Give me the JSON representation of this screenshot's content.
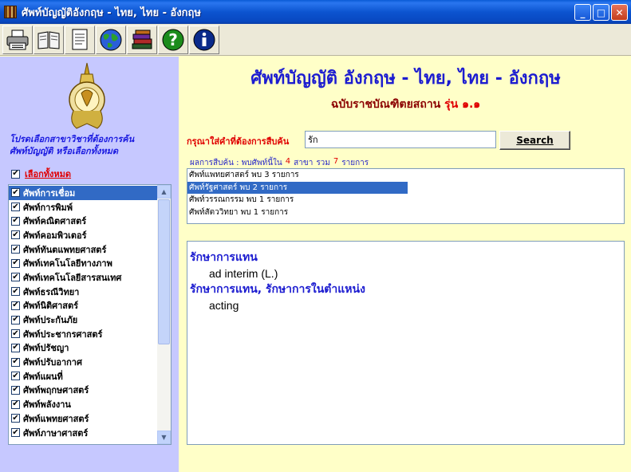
{
  "window": {
    "title": "ศัพท์บัญญัติอังกฤษ - ไทย, ไทย - อังกฤษ",
    "minimize_label": "_",
    "maximize_label": "□",
    "close_label": "✕"
  },
  "toolbar": {
    "buttons": [
      {
        "name": "print",
        "icon": "printer-icon"
      },
      {
        "name": "book",
        "icon": "open-book-icon"
      },
      {
        "name": "document",
        "icon": "document-icon"
      },
      {
        "name": "internet",
        "icon": "globe-icon"
      },
      {
        "name": "library",
        "icon": "stacked-books-icon"
      },
      {
        "name": "help",
        "icon": "question-icon"
      },
      {
        "name": "about",
        "icon": "info-icon"
      }
    ]
  },
  "sidebar": {
    "prompt_line1": "โปรดเลือกสาขาวิชาที่ต้องการค้น",
    "prompt_line2": "ศัพท์บัญญัติ หรือเลือกทั้งหมด",
    "select_all_label": "เลือกทั้งหมด",
    "select_all_checked": true,
    "items": [
      {
        "label": "ศัพท์การเชื่อม",
        "checked": true,
        "selected": true
      },
      {
        "label": "ศัพท์การพิมพ์",
        "checked": true
      },
      {
        "label": "ศัพท์คณิตศาสตร์",
        "checked": true
      },
      {
        "label": "ศัพท์คอมพิวเตอร์",
        "checked": true
      },
      {
        "label": "ศัพท์ทันตแพทยศาสตร์",
        "checked": true
      },
      {
        "label": "ศัพท์เทคโนโลยีทางภาพ",
        "checked": true
      },
      {
        "label": "ศัพท์เทคโนโลยีสารสนเทศ",
        "checked": true
      },
      {
        "label": "ศัพท์ธรณีวิทยา",
        "checked": true
      },
      {
        "label": "ศัพท์นิติศาสตร์",
        "checked": true
      },
      {
        "label": "ศัพท์ประกันภัย",
        "checked": true
      },
      {
        "label": "ศัพท์ประชากรศาสตร์",
        "checked": true
      },
      {
        "label": "ศัพท์ปรัชญา",
        "checked": true
      },
      {
        "label": "ศัพท์ปรับอากาศ",
        "checked": true
      },
      {
        "label": "ศัพท์แผนที่",
        "checked": true
      },
      {
        "label": "ศัพท์พฤกษศาสตร์",
        "checked": true
      },
      {
        "label": "ศัพท์พลังงาน",
        "checked": true
      },
      {
        "label": "ศัพท์แพทยศาสตร์",
        "checked": true
      },
      {
        "label": "ศัพท์ภาษาศาสตร์",
        "checked": true
      }
    ]
  },
  "main": {
    "title": "ศัพท์บัญญัติ อังกฤษ - ไทย, ไทย - อังกฤษ",
    "subtitle": "ฉบับราชบัณฑิตยสถาน",
    "version": "รุ่น ๑.๑",
    "search_label": "กรุณาใส่คำที่ต้องการสืบค้น",
    "search_value": "รัก",
    "search_button": "Search",
    "summary": {
      "prefix": "ผลการสืบค้น : พบศัพท์นี้ใน",
      "count_fields": "4",
      "fields_label": "สาขา",
      "total_label": "รวม",
      "total": "7",
      "items_label": "รายการ"
    },
    "results": [
      {
        "label": "ศัพท์แพทยศาสตร์ พบ 3 รายการ"
      },
      {
        "label": "ศัพท์รัฐศาสตร์ พบ 2 รายการ",
        "selected": true
      },
      {
        "label": "ศัพท์วรรณกรรม พบ 1 รายการ"
      },
      {
        "label": "ศัพท์สัตววิทยา พบ 1 รายการ"
      }
    ],
    "entries": [
      {
        "term": "รักษาการแทน",
        "definition": "ad interim (L.)"
      },
      {
        "term": "รักษาการแทน, รักษาการในตำแหน่ง",
        "definition": "acting"
      }
    ]
  },
  "colors": {
    "sidebar_bg": "#c6c8ff",
    "main_bg": "#ffffc8",
    "title_blue": "#1c1cd0",
    "accent_red": "#e00000",
    "selection": "#316ac5"
  }
}
